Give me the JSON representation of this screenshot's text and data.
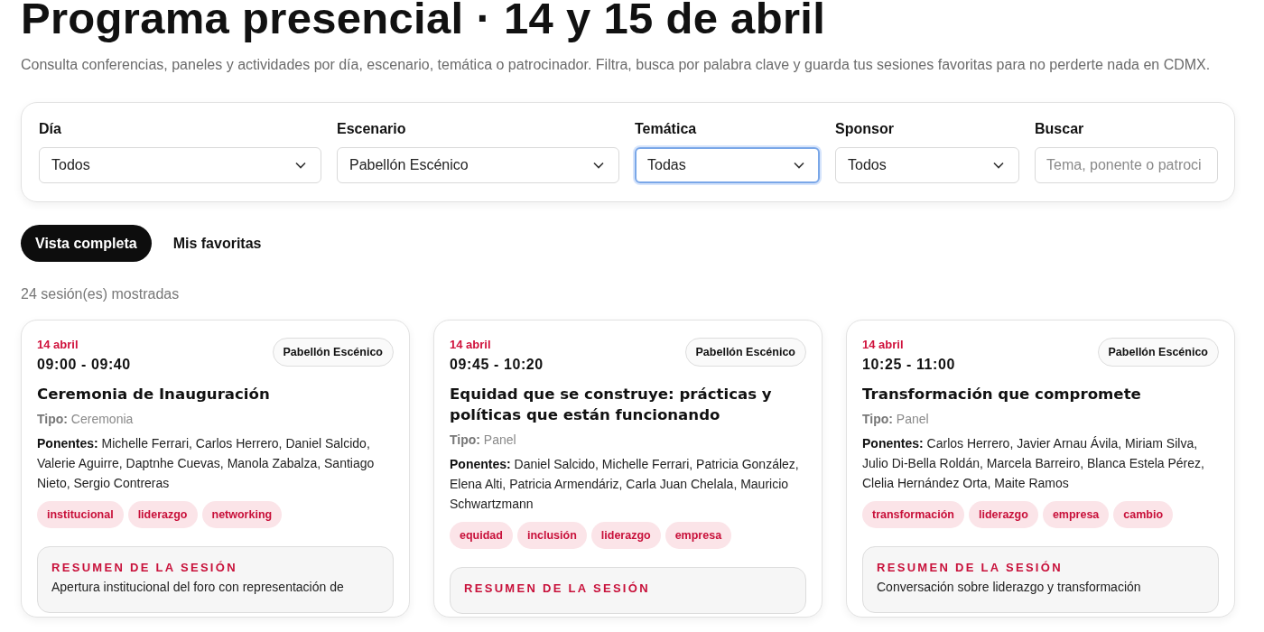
{
  "header": {
    "title": "Programa presencial · 14 y 15 de abril",
    "description": "Consulta conferencias, paneles y actividades por día, escenario, temática o patrocinador. Filtra, busca por palabra clave y guarda tus sesiones favoritas para no perderte nada en CDMX."
  },
  "filters": [
    {
      "kind": "select",
      "label": "Día",
      "value": "Todos",
      "focused": false
    },
    {
      "kind": "select",
      "label": "Escenario",
      "value": "Pabellón Escénico",
      "focused": false
    },
    {
      "kind": "select",
      "label": "Temática",
      "value": "Todas",
      "focused": true
    },
    {
      "kind": "select",
      "label": "Sponsor",
      "value": "Todos",
      "focused": false
    },
    {
      "kind": "search",
      "label": "Buscar",
      "placeholder": "Tema, ponente o patroci"
    }
  ],
  "tabs": [
    {
      "label": "Vista completa",
      "selected": true
    },
    {
      "label": "Mis favoritas",
      "selected": false
    }
  ],
  "count": "24 sesión(es) mostradas",
  "sessions": [
    {
      "date": "14 abril",
      "time": "09:00 - 09:40",
      "stage": "Pabellón Escénico",
      "title": "Ceremonia de Inauguración",
      "type": "**Tipo:** Ceremonia",
      "speakers": "**Ponentes:** Michelle Ferrari, Carlos Herrero, Daniel Salcido, Valerie Aguirre, Daptnhe Cuevas, Manola Zabalza, Santiago Nieto, Sergio Contreras",
      "tags": [
        "institucional",
        "liderazgo",
        "networking"
      ],
      "summary_title": "RESUMEN DE LA SESIÓN",
      "summary": "Apertura institucional del foro con representación de"
    },
    {
      "date": "14 abril",
      "time": "09:45 - 10:20",
      "stage": "Pabellón Escénico",
      "title": "Equidad que se construye: prácticas y políticas que están funcionando",
      "type": "**Tipo:** Panel",
      "speakers": "**Ponentes:** Daniel Salcido, Michelle Ferrari, Patricia González, Elena Alti, Patricia Armendáriz, Carla Juan Chelala, Mauricio Schwartzmann",
      "tags": [
        "equidad",
        "inclusión",
        "liderazgo",
        "empresa"
      ],
      "summary_title": "RESUMEN DE LA SESIÓN"
    },
    {
      "date": "14 abril",
      "time": "10:25 - 11:00",
      "stage": "Pabellón Escénico",
      "title": "Transformación que compromete",
      "type": "**Tipo:** Panel",
      "speakers": "**Ponentes:** Carlos Herrero, Javier Arnau Ávila, Miriam Silva, Julio Di-Bella Roldán, Marcela Barreiro, Blanca Estela Pérez, Clelia Hernández Orta, Maite Ramos",
      "tags": [
        "transformación",
        "liderazgo",
        "empresa",
        "cambio"
      ],
      "summary_title": "RESUMEN DE LA SESIÓN",
      "summary": "Conversación sobre liderazgo y transformación"
    }
  ]
}
